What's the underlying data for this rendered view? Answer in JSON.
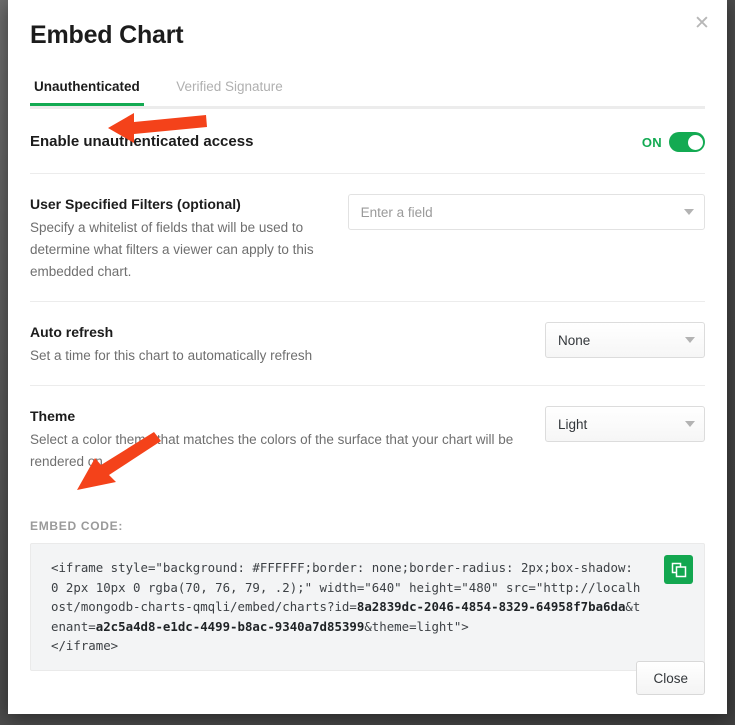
{
  "dialog": {
    "title": "Embed Chart",
    "close_icon": "close-x-icon",
    "close_button_label": "Close"
  },
  "tabs": [
    {
      "label": "Unauthenticated",
      "active": true
    },
    {
      "label": "Verified Signature",
      "active": false
    }
  ],
  "unauthenticated_access": {
    "label": "Enable unauthenticated access",
    "state_label": "ON",
    "enabled": true
  },
  "filters": {
    "title": "User Specified Filters (optional)",
    "description": "Specify a whitelist of fields that will be used to determine what filters a viewer can apply to this embedded chart.",
    "input_value": "",
    "input_placeholder": "Enter a field",
    "caret_icon": "chevron-down-icon"
  },
  "auto_refresh": {
    "title": "Auto refresh",
    "description": "Set a time for this chart to automatically refresh",
    "selected": "None",
    "caret_icon": "chevron-down-icon"
  },
  "theme": {
    "title": "Theme",
    "description": "Select a color theme that matches the colors of the surface that your chart will be rendered on.",
    "selected": "Light",
    "caret_icon": "chevron-down-icon"
  },
  "embed_code": {
    "label": "EMBED CODE:",
    "copy_icon": "copy-documents-icon",
    "segments": [
      {
        "text": "<iframe style=\"background: #FFFFFF;border: none;border-radius: 2px;box-shadow: 0 2px 10px 0 rgba(70, 76, 79, .2);\" width=\"640\" height=\"480\" src=\"http://localhost/mongodb-charts-qmqli/embed/charts?id=",
        "bold": false
      },
      {
        "text": "8a2839dc-2046-4854-8329-64958f7ba6da",
        "bold": true
      },
      {
        "text": "&tenant=",
        "bold": false
      },
      {
        "text": "a2c5a4d8-e1dc-4499-b8ac-9340a7d85399",
        "bold": true
      },
      {
        "text": "&theme=light\">\n</iframe>",
        "bold": false
      }
    ]
  },
  "annotations": [
    {
      "name": "arrow-pointing-at-enable-toggle",
      "color": "#F4421A"
    },
    {
      "name": "arrow-pointing-at-embed-code-label",
      "color": "#F4421A"
    }
  ],
  "colors": {
    "accent_green": "#13aa52",
    "annotation_red": "#F4421A",
    "backdrop": "#4d4d4d"
  }
}
